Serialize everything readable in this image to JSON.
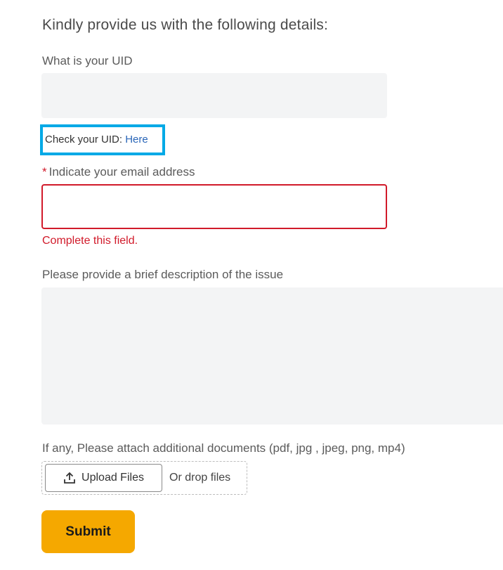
{
  "form": {
    "heading": "Kindly provide us with the following details:",
    "uid": {
      "label": "What is your UID",
      "value": "",
      "placeholder": "",
      "check_text": "Check your UID: ",
      "check_link": "Here"
    },
    "email": {
      "required_marker": "*",
      "label": "Indicate your email address",
      "value": "",
      "placeholder": "",
      "error": "Complete this field."
    },
    "description": {
      "label": "Please provide a brief description of the issue",
      "value": "",
      "placeholder": ""
    },
    "attachments": {
      "label": "If any, Please attach additional documents (pdf, jpg , jpeg, png, mp4)",
      "upload_button": "Upload Files",
      "upload_icon": "upload-icon",
      "drop_text": "Or drop files"
    },
    "submit_label": "Submit"
  },
  "colors": {
    "highlight_border": "#00a9e6",
    "error": "#d11a2a",
    "link": "#2a66b8",
    "submit_bg": "#f5a800",
    "input_bg": "#f3f4f5"
  }
}
